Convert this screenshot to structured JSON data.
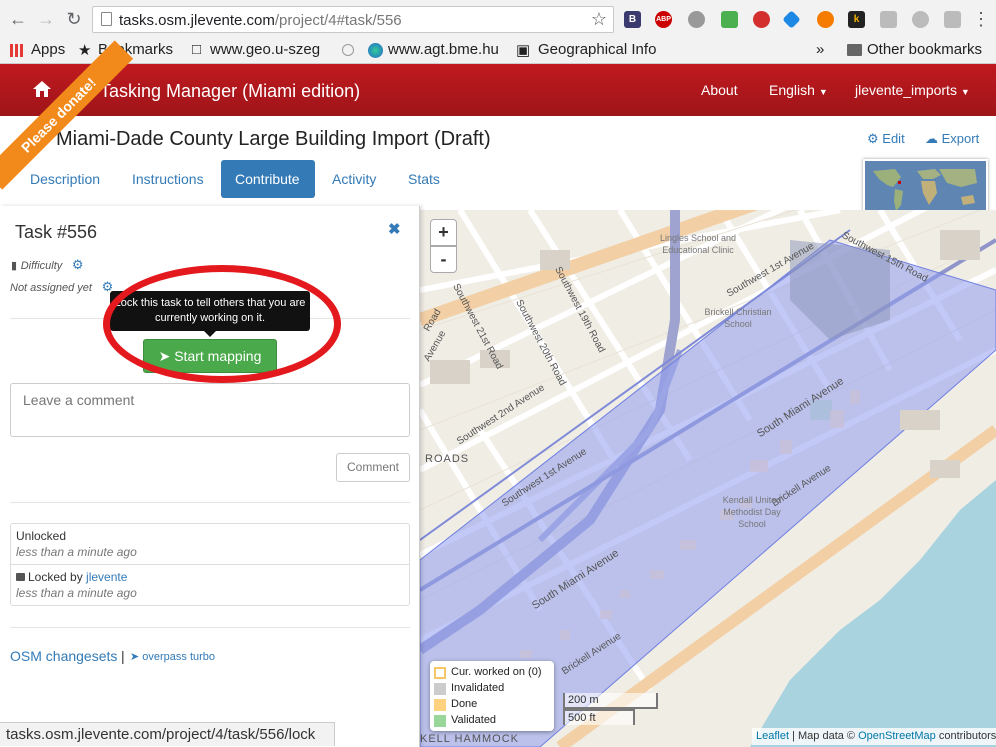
{
  "browser": {
    "url_domain": "tasks.osm.jlevente.com",
    "url_path": "/project/4#task/556",
    "bookmarks": [
      "Apps",
      "Bookmarks",
      "www.geo.u-szeg",
      "",
      "www.agt.bme.hu",
      "Geographical Info",
      "»",
      "Other bookmarks"
    ],
    "extensions": [
      "B",
      "ABP",
      "",
      "",
      "",
      "",
      "",
      "k",
      "",
      "",
      ""
    ]
  },
  "navbar": {
    "brand": "Tasking Manager (Miami edition)",
    "about": "About",
    "language": "English",
    "user": "jlevente_imports",
    "donate": "Please donate!"
  },
  "project": {
    "title": "Miami-Dade County Large Building Import (Draft)",
    "edit": "Edit",
    "export": "Export",
    "tabs": [
      "Description",
      "Instructions",
      "Contribute",
      "Activity",
      "Stats"
    ],
    "active_tab": "Contribute"
  },
  "task": {
    "title": "Task #556",
    "difficulty": "Difficulty",
    "assigned": "Not assigned yet",
    "tooltip": "Lock this task to tell others that you are currently working on it.",
    "start_button": "Start mapping",
    "comment_placeholder": "Leave a comment",
    "comment_button": "Comment",
    "history": [
      {
        "text": "Unlocked",
        "time": "less than a minute ago"
      },
      {
        "text": "Locked by",
        "user": "jlevente",
        "time": "less than a minute ago"
      }
    ],
    "osm_changesets": "OSM changesets",
    "separator": "|",
    "overpass": "overpass turbo"
  },
  "map": {
    "zoom_in": "+",
    "zoom_out": "-",
    "legend": [
      "Cur. worked on (0)",
      "Invalidated",
      "Done",
      "Validated"
    ],
    "legend_colors": [
      "#ffffff",
      "#cccccc",
      "#ffd280",
      "#99d699"
    ],
    "scale_m": "200 m",
    "scale_ft": "500 ft",
    "attribution_leaflet": "Leaflet",
    "attribution_text": "| Map data ©",
    "attribution_osm": "OpenStreetMap",
    "attribution_tail": "contributors",
    "labels": {
      "sw15": "Southwest 15th Road",
      "sw1ave": "Southwest 1st Avenue",
      "sw19": "Southwest 19th Road",
      "sw20": "Southwest 20th Road",
      "sw21": "Southwest 21st Road",
      "sw2ave": "Southwest 2nd Avenue",
      "sw1st": "Southwest 1st Avenue",
      "smiami1": "South Miami Avenue",
      "smiami2": "South Miami Avenue",
      "brickell1": "Brickell Avenue",
      "brickell2": "Brickell Avenue",
      "roads": "ROADS",
      "hammock": "KELL HAMMOCK",
      "avenue_left": "Avenue",
      "road_left": "Road"
    },
    "pois": {
      "lingles": "Lingles School and Educational Clinic",
      "brickell_christian": "Brickell Christian School",
      "kendall": "Kendall United Methodist Day School"
    }
  },
  "statusbar": "tasks.osm.jlevente.com/project/4/task/556/lock"
}
